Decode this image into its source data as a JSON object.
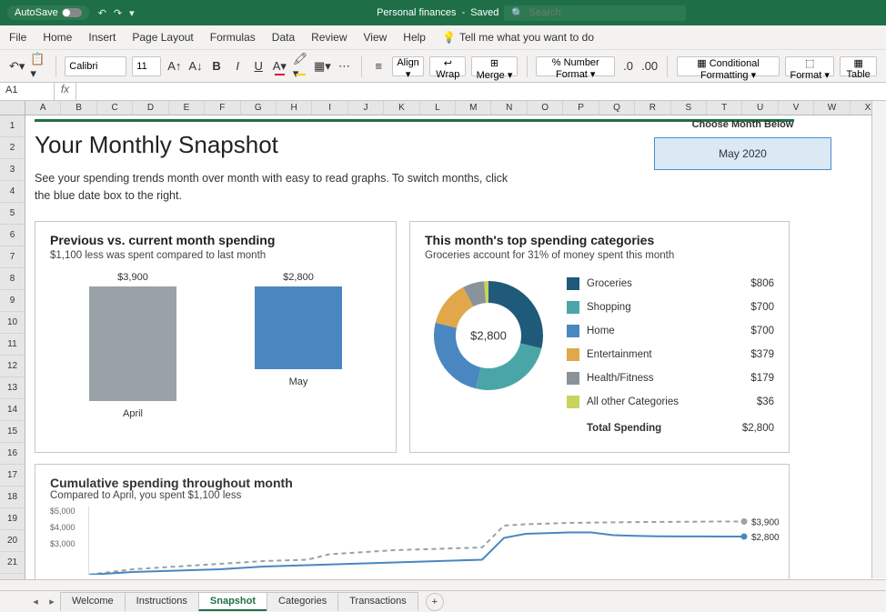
{
  "titlebar": {
    "autosave": "AutoSave",
    "doc_name": "Personal finances",
    "save_status": "Saved",
    "search_placeholder": "Search"
  },
  "menu": {
    "file": "File",
    "home": "Home",
    "insert": "Insert",
    "page_layout": "Page Layout",
    "formulas": "Formulas",
    "data": "Data",
    "review": "Review",
    "view": "View",
    "help": "Help",
    "tellme": "Tell me what you want to do"
  },
  "ribbon": {
    "font_name": "Calibri",
    "font_size": "11",
    "align": "Align",
    "wrap": "Wrap",
    "merge": "Merge",
    "number_format": "Number Format",
    "cond_fmt": "Conditional Formatting",
    "format": "Format",
    "table": "Table"
  },
  "formula": {
    "cell": "A1",
    "value": ""
  },
  "columns": [
    "A",
    "B",
    "C",
    "D",
    "E",
    "F",
    "G",
    "H",
    "I",
    "J",
    "K",
    "L",
    "M",
    "N",
    "O",
    "P",
    "Q",
    "R",
    "S",
    "T",
    "U",
    "V",
    "W",
    "X"
  ],
  "rows_visible": 21,
  "dashboard": {
    "title": "Your Monthly Snapshot",
    "subtitle": "See your spending trends month over month with easy to read graphs. To switch months, click the blue date box to the right.",
    "month_selector": {
      "label": "Choose Month Below",
      "value": "May 2020"
    },
    "card1": {
      "title": "Previous vs. current month spending",
      "subtitle": "$1,100 less was spent compared to last month"
    },
    "card2": {
      "title": "This month's top spending categories",
      "subtitle": "Groceries account for 31% of money spent this month",
      "center": "$2,800",
      "total_label": "Total Spending",
      "total_value": "$2,800"
    },
    "card3": {
      "title": "Cumulative spending throughout month",
      "subtitle": "Compared to April, you spent $1,100 less"
    }
  },
  "chart_data": [
    {
      "id": "card1_bar",
      "type": "bar",
      "categories": [
        "April",
        "May"
      ],
      "values": [
        3900,
        2800
      ],
      "value_labels": [
        "$3,900",
        "$2,800"
      ],
      "series_colors": [
        "#98a2a8",
        "#4a87c0"
      ],
      "ylim": [
        0,
        4000
      ]
    },
    {
      "id": "card2_donut",
      "type": "pie",
      "center_label": "$2,800",
      "series": [
        {
          "name": "Groceries",
          "value": 806,
          "label": "$806",
          "color": "#1f5a7a"
        },
        {
          "name": "Shopping",
          "value": 700,
          "label": "$700",
          "color": "#4aa6a6"
        },
        {
          "name": "Home",
          "value": 700,
          "label": "$700",
          "color": "#4a87c0"
        },
        {
          "name": "Entertainment",
          "value": 379,
          "label": "$379",
          "color": "#e0a84a"
        },
        {
          "name": "Health/Fitness",
          "value": 179,
          "label": "$179",
          "color": "#8a9399"
        },
        {
          "name": "All other Categories",
          "value": 36,
          "label": "$36",
          "color": "#c8d45a"
        }
      ],
      "total": 2800
    },
    {
      "id": "card3_line",
      "type": "line",
      "ylabel": "",
      "ylim": [
        0,
        5000
      ],
      "yticks": [
        "$5,000",
        "$4,000",
        "$3,000"
      ],
      "series": [
        {
          "name": "April",
          "end_label": "$3,900",
          "color": "#98a2a8",
          "dashed": true,
          "values": [
            0,
            200,
            400,
            500,
            600,
            700,
            800,
            900,
            1000,
            1050,
            1100,
            1500,
            1600,
            1700,
            1800,
            1850,
            1900,
            1950,
            2000,
            3600,
            3700,
            3750,
            3800,
            3820,
            3840,
            3860,
            3870,
            3880,
            3890,
            3900,
            3900
          ]
        },
        {
          "name": "May",
          "end_label": "$2,800",
          "color": "#4a87c0",
          "dashed": false,
          "values": [
            0,
            100,
            200,
            250,
            300,
            350,
            400,
            500,
            600,
            650,
            700,
            750,
            800,
            850,
            900,
            950,
            1000,
            1050,
            1100,
            2700,
            3000,
            3050,
            3100,
            3100,
            2900,
            2850,
            2820,
            2810,
            2805,
            2800,
            2800
          ]
        }
      ]
    }
  ],
  "sheet_tabs": {
    "items": [
      "Welcome",
      "Instructions",
      "Snapshot",
      "Categories",
      "Transactions"
    ],
    "active": "Snapshot"
  }
}
